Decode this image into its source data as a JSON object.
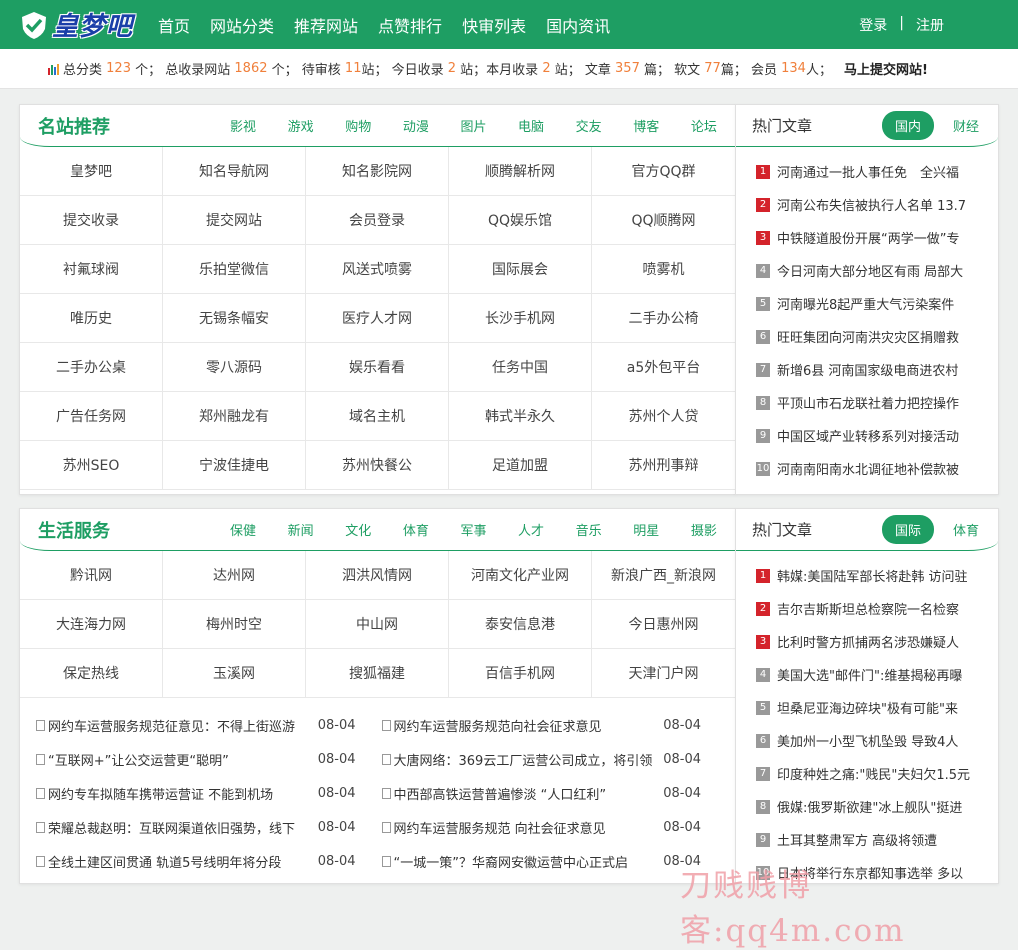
{
  "brand": {
    "logo_text": "皇梦吧"
  },
  "nav": [
    "首页",
    "网站分类",
    "推荐网站",
    "点赞排行",
    "快审列表",
    "国内资讯"
  ],
  "auth": {
    "login": "登录",
    "sep": "|",
    "register": "注册"
  },
  "stats": {
    "l1": "总分类",
    "v1": "123",
    "l2": "个； 总收录网站",
    "v2": "1862",
    "l3": "个； 待审核",
    "v3": "11",
    "l4": "站； 今日收录",
    "v4": "2",
    "l5": "站；本月收录",
    "v5": "2",
    "l6": "站； 文章",
    "v6": "357",
    "l7": "篇； 软文",
    "v7": "77",
    "l8": "篇； 会员",
    "v8": "134",
    "l9": "人；",
    "submit": "马上提交网站!"
  },
  "famous": {
    "title": "名站推荐",
    "cats": [
      "影视",
      "游戏",
      "购物",
      "动漫",
      "图片",
      "电脑",
      "交友",
      "博客",
      "论坛"
    ],
    "sites": [
      "皇梦吧",
      "知名导航网",
      "知名影院网",
      "顺腾解析网",
      "官方QQ群",
      "提交收录",
      "提交网站",
      "会员登录",
      "QQ娱乐馆",
      "QQ顺腾网",
      "衬氟球阀",
      "乐拍堂微信",
      "风送式喷雾",
      "国际展会",
      "喷雾机",
      "唯历史",
      "无锡条幅安",
      "医疗人才网",
      "长沙手机网",
      "二手办公椅",
      "二手办公桌",
      "零八源码",
      "娱乐看看",
      "任务中国",
      "a5外包平台",
      "广告任务网",
      "郑州融龙有",
      "域名主机",
      "韩式半永久",
      "苏州个人贷",
      "苏州SEO",
      "宁波佳捷电",
      "苏州快餐公",
      "足道加盟",
      "苏州刑事辩"
    ]
  },
  "hot1": {
    "title": "热门文章",
    "tabs": [
      "国内",
      "财经"
    ],
    "items": [
      "河南通过一批人事任免　全兴福",
      "河南公布失信被执行人名单 13.7",
      "中铁隧道股份开展“两学一做”专",
      "今日河南大部分地区有雨 局部大",
      "河南曝光8起严重大气污染案件",
      "旺旺集团向河南洪灾灾区捐赠救",
      "新增6县 河南国家级电商进农村",
      "平顶山市石龙联社着力把控操作",
      "中国区域产业转移系列对接活动",
      "河南南阳南水北调征地补偿款被"
    ]
  },
  "life": {
    "title": "生活服务",
    "cats": [
      "保健",
      "新闻",
      "文化",
      "体育",
      "军事",
      "人才",
      "音乐",
      "明星",
      "摄影"
    ],
    "sites": [
      "黔讯网",
      "达州网",
      "泗洪风情网",
      "河南文化产业网",
      "新浪广西_新浪网",
      "大连海力网",
      "梅州时空",
      "中山网",
      "泰安信息港",
      "今日惠州网",
      "保定热线",
      "玉溪网",
      "搜狐福建",
      "百信手机网",
      "天津门户网"
    ],
    "news": [
      {
        "t": "网约车运营服务规范征意见：不得上街巡游",
        "d": "08-04"
      },
      {
        "t": "网约车运营服务规范向社会征求意见",
        "d": "08-04"
      },
      {
        "t": "“互联网+”让公交运营更“聪明”",
        "d": "08-04"
      },
      {
        "t": "大唐网络：369云工厂运营公司成立，将引领",
        "d": "08-04"
      },
      {
        "t": "网约专车拟随车携带运营证 不能到机场",
        "d": "08-04"
      },
      {
        "t": "中西部高铁运营普遍惨淡 “人口红利”",
        "d": "08-04"
      },
      {
        "t": "荣耀总裁赵明：互联网渠道依旧强势，线下",
        "d": "08-04"
      },
      {
        "t": "网约车运营服务规范 向社会征求意见",
        "d": "08-04"
      },
      {
        "t": "全线土建区间贯通 轨道5号线明年将分段",
        "d": "08-04"
      },
      {
        "t": "“一城一策”？华裔网安徽运营中心正式启",
        "d": "08-04"
      }
    ]
  },
  "hot2": {
    "title": "热门文章",
    "tabs": [
      "国际",
      "体育"
    ],
    "items": [
      "韩媒:美国陆军部长将赴韩 访问驻",
      "吉尔吉斯斯坦总检察院一名检察",
      "比利时警方抓捕两名涉恐嫌疑人",
      "美国大选\"邮件门\":维基揭秘再曝",
      "坦桑尼亚海边碎块\"极有可能\"来",
      "美加州一小型飞机坠毁 导致4人",
      "印度种姓之痛:\"贱民\"夫妇欠1.5元",
      "俄媒:俄罗斯欲建\"冰上舰队\"挺进",
      "土耳其整肃军方 高级将领遭",
      "日本将举行东京都知事选举 多以"
    ]
  },
  "watermark": "刀贱贱博客:qq4m.com"
}
